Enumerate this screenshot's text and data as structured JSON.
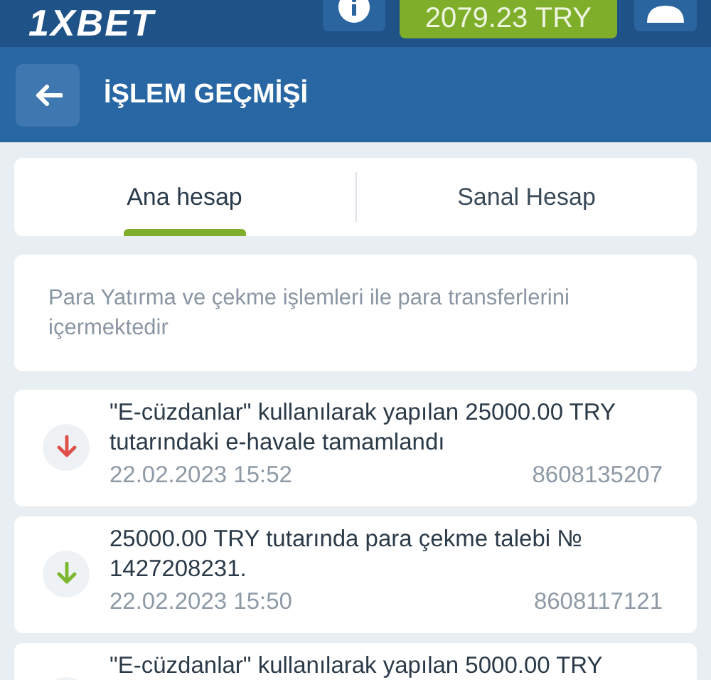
{
  "topbar": {
    "logo": "1XBET",
    "balance": "2079.23 TRY"
  },
  "header": {
    "title": "İŞLEM GEÇMİŞİ"
  },
  "tabs": [
    {
      "label": "Ana hesap",
      "selected": true
    },
    {
      "label": "Sanal Hesap",
      "selected": false
    }
  ],
  "notice": "Para Yatırma ve çekme işlemleri ile para transferlerini içermektedir",
  "transactions": [
    {
      "text": "\"E-cüzdanlar\" kullanılarak yapılan 25000.00 TRY tutarındaki e-havale tamamlandı",
      "date": "22.02.2023 15:52",
      "id": "8608135207",
      "color": "#e0504a"
    },
    {
      "text": "25000.00 TRY tutarında para çekme talebi № 1427208231.",
      "date": "22.02.2023 15:50",
      "id": "8608117121",
      "color": "#7cb82f"
    },
    {
      "text": "\"E-cüzdanlar\" kullanılarak yapılan 5000.00 TRY"
    }
  ]
}
